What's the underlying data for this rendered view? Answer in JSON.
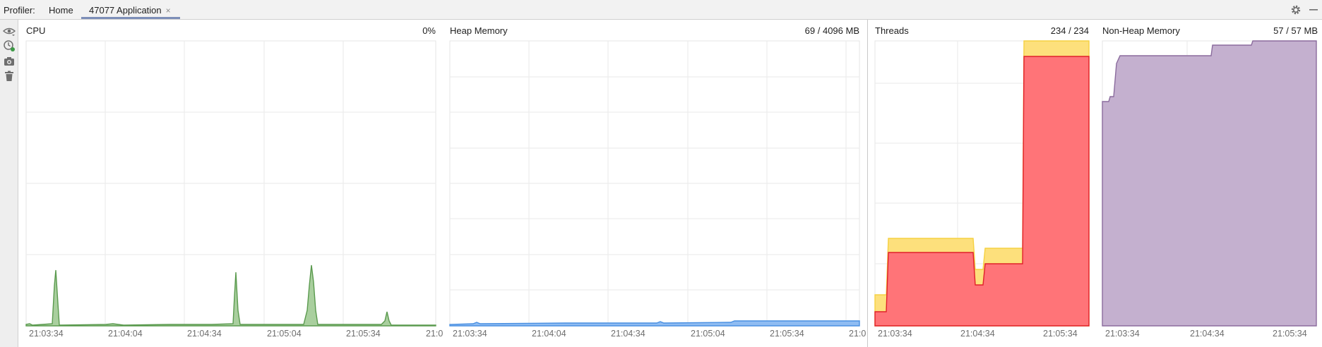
{
  "toolbar": {
    "profiler_label": "Profiler:",
    "tabs": [
      {
        "label": "Home"
      },
      {
        "label": "47077 Application",
        "close": "×"
      }
    ]
  },
  "icons": {
    "settings": "gear-icon",
    "minimize": "minimize-icon",
    "left": [
      "eye-icon",
      "record-clock-icon",
      "camera-icon",
      "trash-icon"
    ]
  },
  "panels": {
    "cpu": {
      "title": "CPU",
      "value": "0%",
      "ticks": [
        "21:03:34",
        "21:04:04",
        "21:04:34",
        "21:05:04",
        "21:05:34",
        "21:0"
      ]
    },
    "heap": {
      "title": "Heap Memory",
      "value": "69 / 4096 MB",
      "ticks": [
        "21:03:34",
        "21:04:04",
        "21:04:34",
        "21:05:04",
        "21:05:34",
        "21:0"
      ]
    },
    "threads": {
      "title": "Threads",
      "value": "234 / 234",
      "ticks": [
        "21:03:34",
        "21:04:34",
        "21:05:34"
      ]
    },
    "nonheap": {
      "title": "Non-Heap Memory",
      "value": "57 / 57 MB",
      "ticks": [
        "21:03:34",
        "21:04:34",
        "21:05:34"
      ]
    }
  },
  "colors": {
    "cpu": "#5a9a4e",
    "cpu_fill": "#a9cf9e",
    "heap": "#4a90e2",
    "heap_fill": "#8fbcf2",
    "threads_total": "#f5d142",
    "threads_total_fill": "#fde07c",
    "threads_active": "#e0202a",
    "threads_active_fill": "#ff7478",
    "nonheap": "#8b6c9e",
    "nonheap_fill": "#c4b0cf"
  }
}
